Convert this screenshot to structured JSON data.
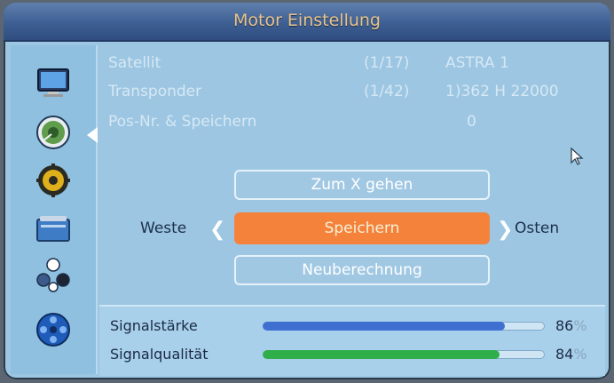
{
  "header": {
    "title": "Motor Einstellung"
  },
  "sidebar": {
    "items": [
      {
        "icon": "tv-icon"
      },
      {
        "icon": "satellite-dish-icon",
        "selected": true
      },
      {
        "icon": "settings-gear-icon"
      },
      {
        "icon": "media-box-icon"
      },
      {
        "icon": "network-icon"
      },
      {
        "icon": "film-reel-icon"
      }
    ]
  },
  "info": {
    "satellite": {
      "label": "Satellit",
      "index": "(1/17)",
      "value": "ASTRA 1"
    },
    "transponder": {
      "label": "Transponder",
      "index": "(1/42)",
      "value": "1)362 H 22000"
    },
    "position": {
      "label": "Pos-Nr. & Speichern",
      "value": "0"
    }
  },
  "actions": {
    "goto_x": "Zum X gehen",
    "save": "Speichern",
    "recalc": "Neuberechnung",
    "west": "Weste",
    "east": "Osten"
  },
  "signal": {
    "strength": {
      "label": "Signalstärke",
      "value": "86",
      "unit": "%",
      "fraction": 0.86
    },
    "quality": {
      "label": "Signalqualität",
      "value": "84",
      "unit": "%",
      "fraction": 0.84
    }
  },
  "colors": {
    "highlight": "#f5823a",
    "strength_bar": "#3f6fd0",
    "quality_bar": "#2fae4a",
    "title_text": "#e9c48a"
  }
}
